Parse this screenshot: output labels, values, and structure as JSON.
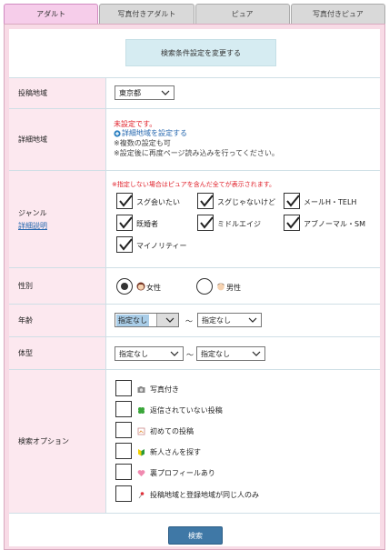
{
  "tabs": [
    {
      "label": "アダルト",
      "active": true
    },
    {
      "label": "写真付きアダルト",
      "active": false
    },
    {
      "label": "ピュア",
      "active": false
    },
    {
      "label": "写真付きピュア",
      "active": false
    }
  ],
  "change_button": "検索条件設定を変更する",
  "area": {
    "label": "投稿地域",
    "value": "東京都"
  },
  "detail_area": {
    "label": "詳細地域",
    "status": "未設定です。",
    "link": "詳細地域を設定する",
    "note1": "※複数の設定も可",
    "note2": "※設定後に再度ページ読み込みを行ってください。"
  },
  "genre": {
    "label": "ジャンル",
    "detail_link": "詳細説明",
    "note": "※指定しない場合はピュアを含んだ全てが表示されます。",
    "items": [
      {
        "label": "スグ会いたい",
        "checked": true
      },
      {
        "label": "スグじゃないけど",
        "checked": true
      },
      {
        "label": "メールH・TELH",
        "checked": true
      },
      {
        "label": "既婚者",
        "checked": true
      },
      {
        "label": "ミドルエイジ",
        "checked": true
      },
      {
        "label": "アブノーマル・SM",
        "checked": true
      },
      {
        "label": "マイノリティー",
        "checked": true
      }
    ]
  },
  "gender": {
    "label": "性別",
    "female": "女性",
    "male": "男性",
    "selected": "female"
  },
  "age": {
    "label": "年齢",
    "from": "指定なし",
    "tilde": "〜",
    "to": "指定なし"
  },
  "body": {
    "label": "体型",
    "from": "指定なし",
    "tilde": "〜",
    "to": "指定なし"
  },
  "options": {
    "label": "検索オプション",
    "items": [
      {
        "label": "写真付き",
        "icon": "camera-icon",
        "checked": false
      },
      {
        "label": "返信されていない投稿",
        "icon": "clover-icon",
        "checked": false
      },
      {
        "label": "初めての投稿",
        "icon": "note-icon",
        "checked": false
      },
      {
        "label": "新人さんを探す",
        "icon": "beginner-mark-icon",
        "checked": false
      },
      {
        "label": "裏プロフィールあり",
        "icon": "heart-icon",
        "checked": false
      },
      {
        "label": "投稿地域と登録地域が同じ人のみ",
        "icon": "pin-icon",
        "checked": false
      }
    ]
  },
  "submit": "検索",
  "colors": {
    "tab_active": "#f6cdea",
    "panel_bg": "#f8dbe6",
    "label_bg": "#fce8ef",
    "alert": "#e0202a",
    "link": "#2a6ab0",
    "submit_bg": "#3f78a6"
  }
}
